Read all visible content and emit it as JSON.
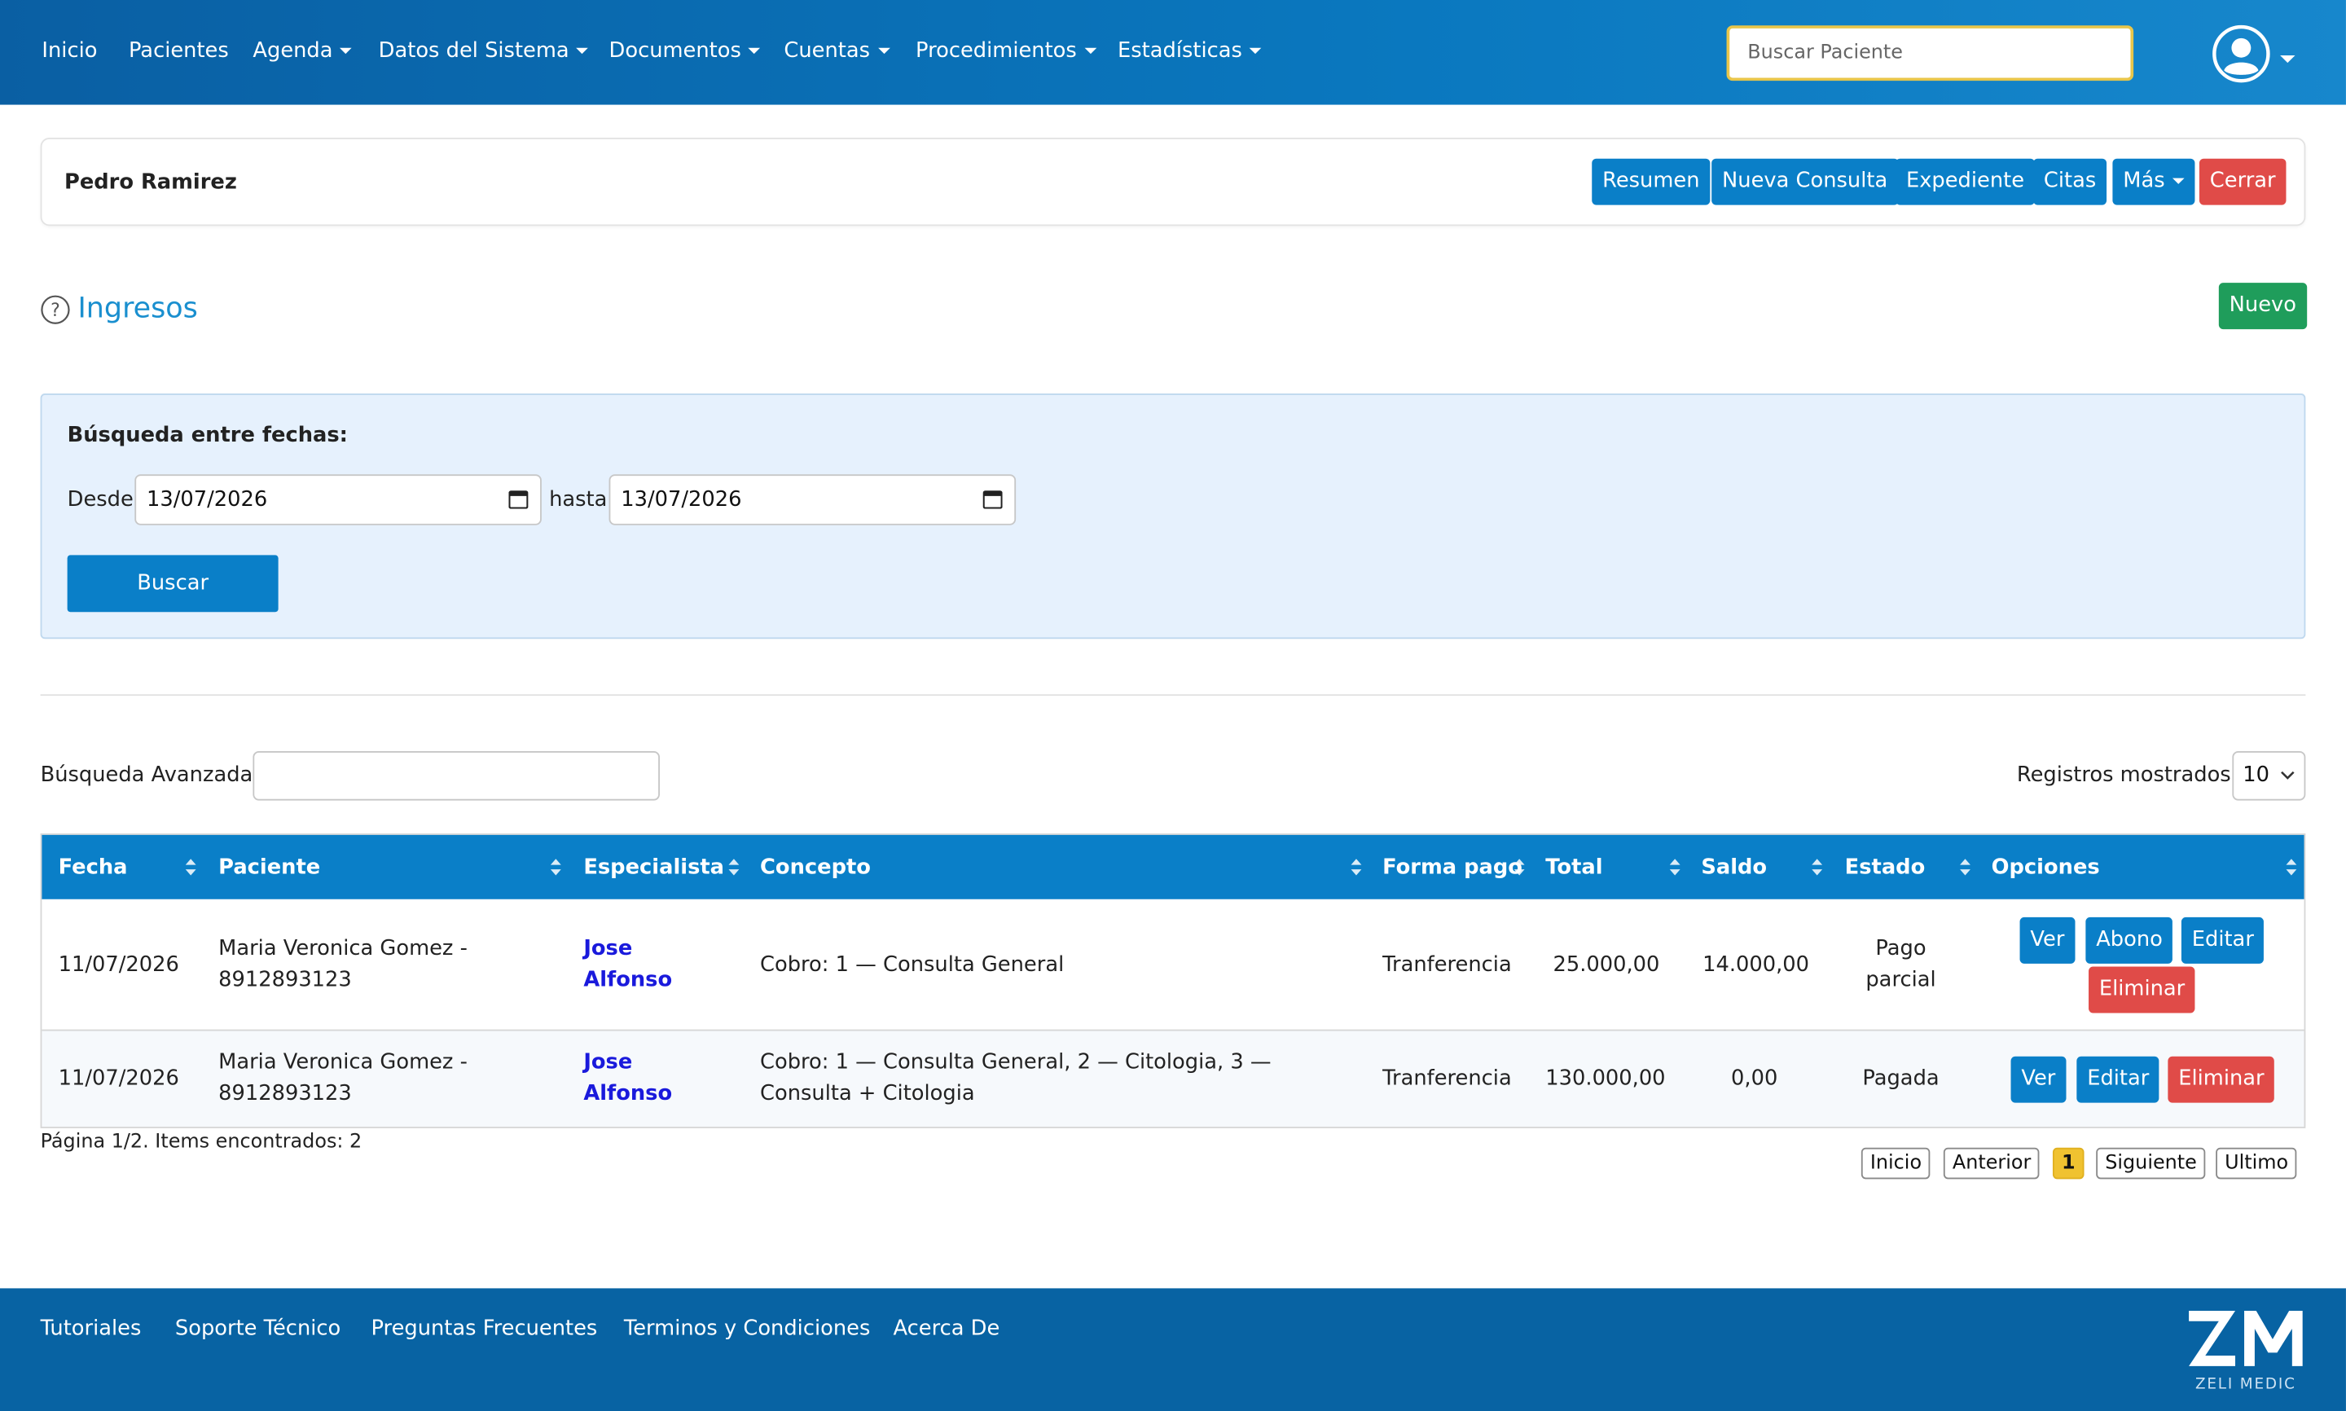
{
  "navbar": {
    "items": [
      {
        "label": "Inicio",
        "dropdown": false
      },
      {
        "label": "Pacientes",
        "dropdown": false
      },
      {
        "label": "Agenda",
        "dropdown": true
      },
      {
        "label": "Datos del Sistema",
        "dropdown": true
      },
      {
        "label": "Documentos",
        "dropdown": true
      },
      {
        "label": "Cuentas",
        "dropdown": true
      },
      {
        "label": "Procedimientos",
        "dropdown": true
      },
      {
        "label": "Estadísticas",
        "dropdown": true
      }
    ],
    "search_placeholder": "Buscar Paciente",
    "avatar_icon": "user-circle-icon"
  },
  "patient_card": {
    "name": "Pedro Ramirez",
    "buttons": {
      "resumen": "Resumen",
      "nueva_consulta": "Nueva Consulta",
      "expediente": "Expediente",
      "citas": "Citas",
      "mas": "Más",
      "cerrar": "Cerrar"
    }
  },
  "page": {
    "title": "Ingresos",
    "new_button": "Nuevo"
  },
  "date_search": {
    "title": "Búsqueda entre fechas:",
    "from_label": "Desde",
    "from_value": "13/07/2026",
    "to_label": "hasta",
    "to_value": "13/07/2026",
    "search_button": "Buscar"
  },
  "table_controls": {
    "advanced_search_label": "Búsqueda Avanzada:",
    "advanced_search_value": "",
    "records_label": "Registros mostrados:",
    "records_value": "10"
  },
  "table": {
    "headers": [
      "Fecha",
      "Paciente",
      "Especialista",
      "Concepto",
      "Forma pago",
      "Total",
      "Saldo",
      "Estado",
      "Opciones"
    ],
    "rows": [
      {
        "fecha": "11/07/2026",
        "paciente_line1": "Maria Veronica Gomez -",
        "paciente_line2": "8912893123",
        "especialista_line1": "Jose",
        "especialista_line2": "Alfonso",
        "concepto_line1": "Cobro: 1 — Consulta General",
        "concepto_line2": "",
        "forma_pago": "Tranferencia",
        "total": "25.000,00",
        "saldo": "14.000,00",
        "estado_line1": "Pago",
        "estado_line2": "parcial",
        "actions": {
          "ver": "Ver",
          "abono": "Abono",
          "editar": "Editar",
          "eliminar": "Eliminar"
        }
      },
      {
        "fecha": "11/07/2026",
        "paciente_line1": "Maria Veronica Gomez -",
        "paciente_line2": "8912893123",
        "especialista_line1": "Jose",
        "especialista_line2": "Alfonso",
        "concepto_line1": "Cobro: 1 — Consulta General, 2 — Citologia, 3 —",
        "concepto_line2": "Consulta + Citologia",
        "forma_pago": "Tranferencia",
        "total": "130.000,00",
        "saldo": "0,00",
        "estado_line1": "Pagada",
        "estado_line2": "",
        "actions": {
          "ver": "Ver",
          "editar": "Editar",
          "eliminar": "Eliminar"
        }
      }
    ]
  },
  "pagination": {
    "info": "Página 1/2. Items encontrados: 2",
    "first": "Inicio",
    "prev": "Anterior",
    "current": "1",
    "next": "Siguiente",
    "last": "Ultimo"
  },
  "footer": {
    "links": [
      "Tutoriales",
      "Soporte Técnico",
      "Preguntas Frecuentes",
      "Terminos y Condiciones",
      "Acerca De"
    ],
    "logo_text": "ZELI MEDIC"
  },
  "colors": {
    "nav_blue": "#0a78bf",
    "primary": "#0a7fc8",
    "danger": "#e04b48",
    "success": "#1f9d5b",
    "footer": "#0863a3",
    "page_active": "#f0c230"
  }
}
